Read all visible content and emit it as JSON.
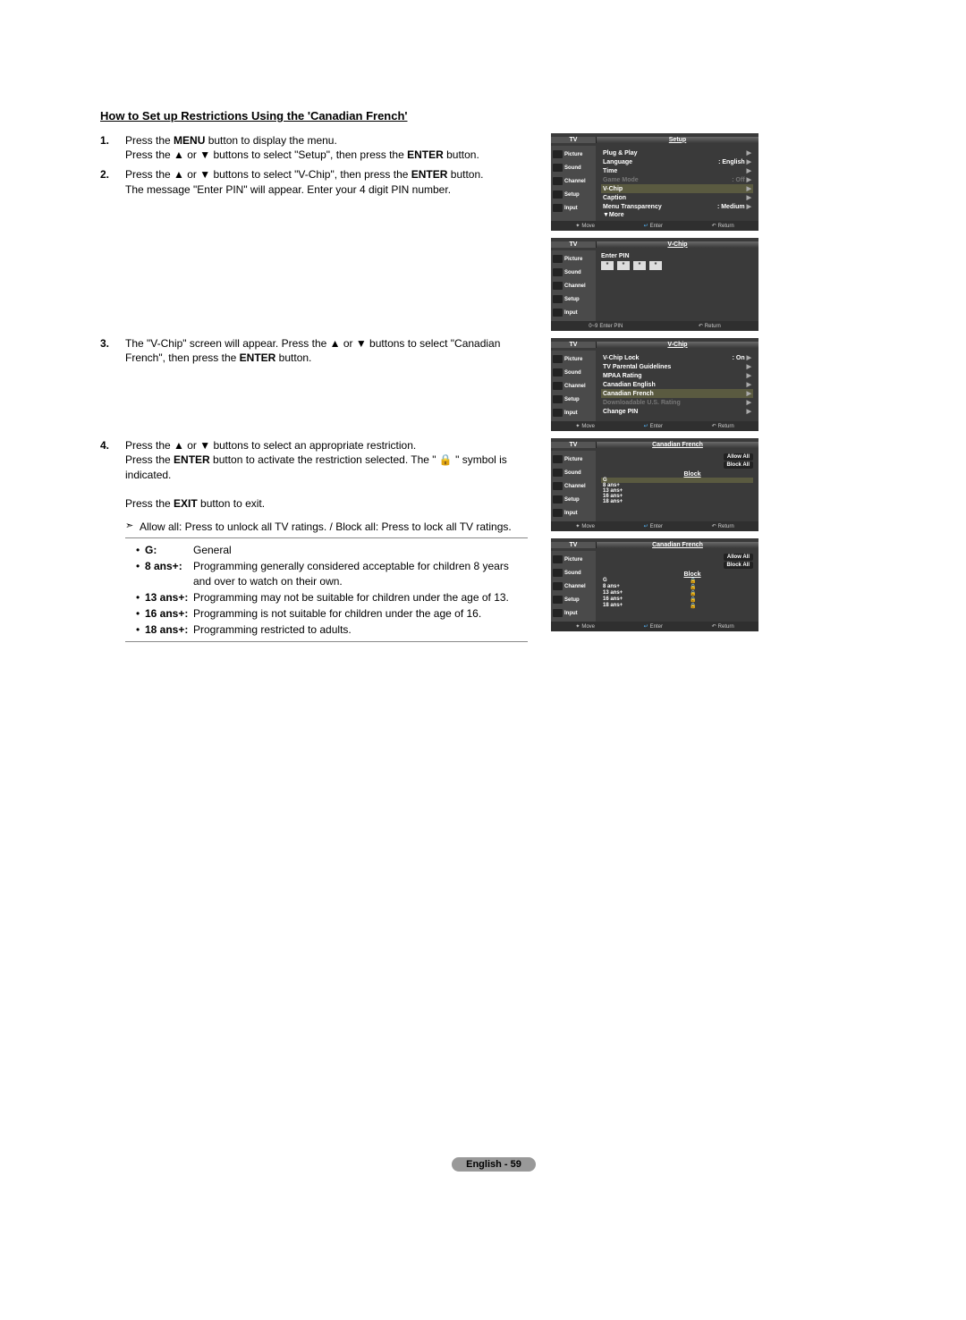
{
  "title": "How to Set up Restrictions Using the 'Canadian French'",
  "steps": {
    "1": {
      "num": "1.",
      "a": "Press the ",
      "b": "MENU",
      "c": " button to display the menu.",
      "d": "Press the ▲ or ▼ buttons to select \"Setup\", then press the ",
      "e": "ENTER",
      "f": " button."
    },
    "2": {
      "num": "2.",
      "a": "Press the ▲ or ▼ buttons to select \"V-Chip\", then press the ",
      "b": "ENTER",
      "c": " button.",
      "d": "The message \"Enter PIN\" will appear. Enter your 4 digit PIN number."
    },
    "3": {
      "num": "3.",
      "a": "The \"V-Chip\" screen will appear. Press the ▲ or ▼ buttons to select \"Canadian French\", then press the ",
      "b": "ENTER",
      "c": " button."
    },
    "4": {
      "num": "4.",
      "a": "Press the ▲ or ▼ buttons to select an appropriate restriction.",
      "b1": "Press the ",
      "b2": "ENTER",
      "b3": " button to activate the restriction selected. The \" ",
      "b_icon": "🔒",
      "b4": " \" symbol is indicated.",
      "c1": "Press the ",
      "c2": "EXIT",
      "c3": " button to exit."
    }
  },
  "note": "Allow all: Press to unlock all TV ratings. / Block all: Press to lock all TV ratings.",
  "ratings": {
    "G": {
      "k": "G:",
      "v": "General"
    },
    "8": {
      "k": "8 ans+:",
      "v": "Programming generally considered acceptable for children 8 years and over to watch on their own."
    },
    "13": {
      "k": "13 ans+:",
      "v": "Programming may not be suitable for children under the age of 13."
    },
    "16": {
      "k": "16 ans+:",
      "v": "Programming is not suitable for children under the age of 16."
    },
    "18": {
      "k": "18 ans+:",
      "v": "Programming restricted to adults."
    }
  },
  "osd": {
    "tv": "TV",
    "sidebar": [
      "Picture",
      "Sound",
      "Channel",
      "Setup",
      "Input"
    ],
    "foot": {
      "move": "Move",
      "enter": "Enter",
      "return": "Return",
      "enterpin": "Enter PIN"
    },
    "s1": {
      "title": "Setup",
      "items": [
        {
          "l": "Plug & Play",
          "r": "",
          "tri": "▶"
        },
        {
          "l": "Language",
          "r": ": English",
          "tri": "▶"
        },
        {
          "l": "Time",
          "r": "",
          "tri": "▶"
        },
        {
          "l": "Game Mode",
          "r": ": Off",
          "tri": "▶",
          "dim": true
        },
        {
          "l": "V-Chip",
          "r": "",
          "tri": "▶",
          "hl": true
        },
        {
          "l": "Caption",
          "r": "",
          "tri": "▶"
        },
        {
          "l": "Menu Transparency",
          "r": ": Medium",
          "tri": "▶"
        },
        {
          "l": "▼More",
          "r": "",
          "tri": ""
        }
      ]
    },
    "s2": {
      "title": "V-Chip",
      "label": "Enter PIN"
    },
    "s3": {
      "title": "V-Chip",
      "items": [
        {
          "l": "V-Chip Lock",
          "r": ": On",
          "tri": "▶"
        },
        {
          "l": "TV Parental Guidelines",
          "r": "",
          "tri": "▶"
        },
        {
          "l": "MPAA Rating",
          "r": "",
          "tri": "▶"
        },
        {
          "l": "Canadian English",
          "r": "",
          "tri": "▶"
        },
        {
          "l": "Canadian French",
          "r": "",
          "tri": "▶",
          "hl": true
        },
        {
          "l": "Downloadable U.S. Rating",
          "r": "",
          "tri": "▶",
          "dim": true
        },
        {
          "l": "Change PIN",
          "r": "",
          "tri": "▶"
        }
      ]
    },
    "s4": {
      "title": "Canadian French",
      "allow": "Allow All",
      "block": "Block All",
      "col": "Block",
      "rows": [
        {
          "l": "G",
          "hl": true
        },
        {
          "l": "8 ans+"
        },
        {
          "l": "13 ans+"
        },
        {
          "l": "16 ans+"
        },
        {
          "l": "18 ans+"
        }
      ]
    },
    "s5": {
      "title": "Canadian French",
      "allow": "Allow All",
      "block": "Block All",
      "col": "Block",
      "rows": [
        {
          "l": "G",
          "lock": true
        },
        {
          "l": "8 ans+",
          "lock": true
        },
        {
          "l": "13 ans+",
          "lock": true
        },
        {
          "l": "16 ans+",
          "lock": true
        },
        {
          "l": "18 ans+",
          "lock": true
        }
      ]
    }
  },
  "footer": "English - 59"
}
